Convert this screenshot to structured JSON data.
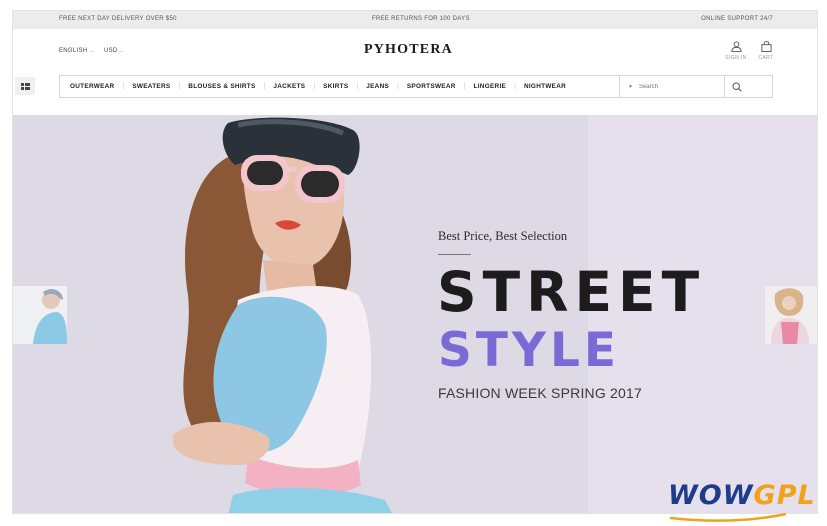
{
  "topbar": {
    "left": "FREE NEXT DAY DELIVERY OVER $50",
    "center": "FREE RETURNS FOR 100 DAYS",
    "right": "ONLINE SUPPORT 24/7"
  },
  "header": {
    "language": "ENGLISH",
    "currency": "USD",
    "logo": "PYHOTERA",
    "sign_in_label": "SIGN IN",
    "cart_label": "CART"
  },
  "nav": {
    "items": [
      "OUTERWEAR",
      "SWEATERS",
      "BLOUSES & SHIRTS",
      "JACKETS",
      "SKIRTS",
      "JEANS",
      "SPORTSWEAR",
      "LINGERIE",
      "NIGHTWEAR"
    ],
    "search_placeholder": "Search"
  },
  "hero": {
    "subtitle": "Best Price, Best Selection",
    "headline_1": "STREET",
    "headline_2": "STYLE",
    "tagline": "FASHION WEEK SPRING 2017"
  },
  "watermark": {
    "part1": "WOW",
    "part2": "GPL"
  },
  "colors": {
    "accent": "#7a6ad6",
    "hero_bg": "#e6dfec",
    "topbar_bg": "#ececec",
    "watermark_blue": "#1d3d8a",
    "watermark_orange": "#f0a21a"
  },
  "icons": {
    "menu_toggle": "grid-icon",
    "sign_in": "user-icon",
    "cart": "bag-icon",
    "search": "search-icon",
    "search_dropdown": "caret-down-icon"
  }
}
